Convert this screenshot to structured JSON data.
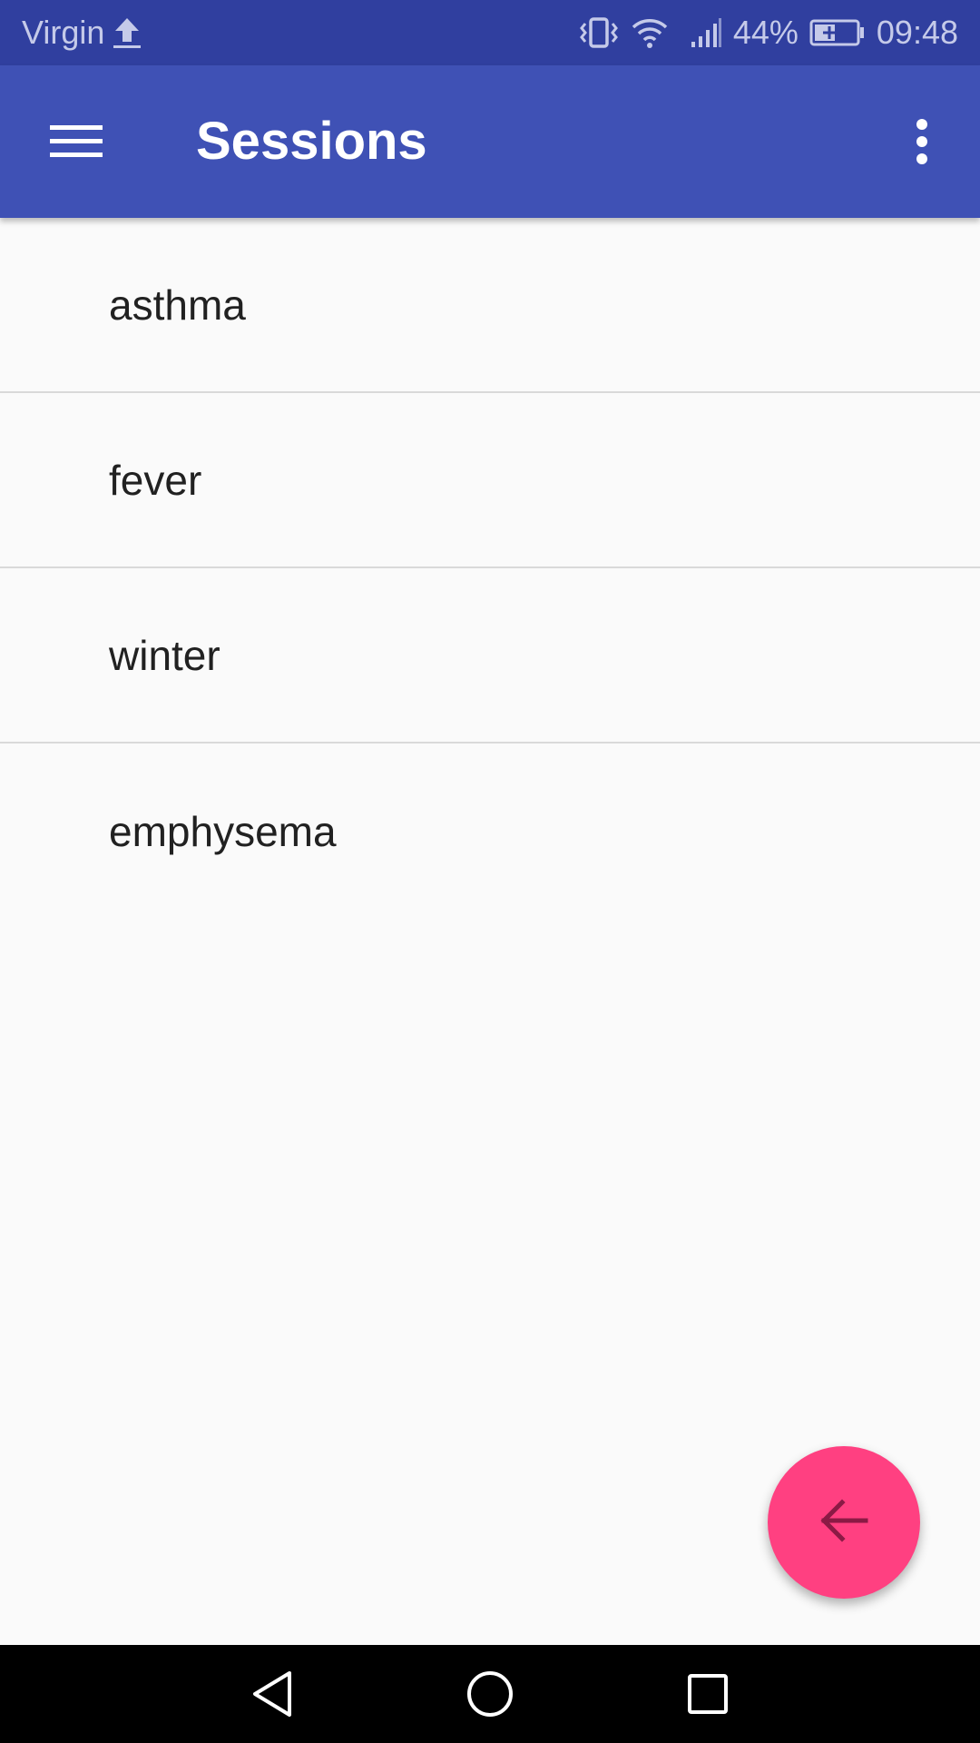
{
  "status_bar": {
    "carrier": "Virgin",
    "battery_percent": "44%",
    "time": "09:48",
    "icons": [
      "upload-icon",
      "vibrate-icon",
      "wifi-icon",
      "signal-icon",
      "battery-charging-icon"
    ]
  },
  "app_bar": {
    "title": "Sessions",
    "menu_icon": "hamburger-menu-icon",
    "overflow_icon": "more-vert-icon",
    "color": "#3f51b5"
  },
  "sessions": [
    {
      "label": "asthma"
    },
    {
      "label": "fever"
    },
    {
      "label": "winter"
    },
    {
      "label": "emphysema"
    }
  ],
  "fab": {
    "icon": "arrow-back-icon",
    "color": "#ff4081"
  },
  "nav_bar": {
    "icons": [
      "back-triangle-icon",
      "home-circle-icon",
      "recents-square-icon"
    ]
  }
}
